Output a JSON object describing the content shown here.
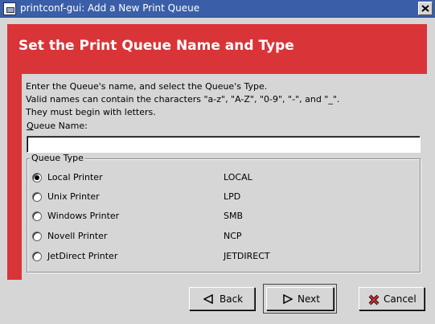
{
  "window": {
    "title": "printconf-gui: Add a New Print Queue"
  },
  "header": {
    "title": "Set the Print Queue Name and Type"
  },
  "instructions": [
    "Enter the Queue's name, and select the Queue's Type.",
    "Valid names can contain the characters \"a-z\", \"A-Z\", \"0-9\", \"-\", and \"_\".",
    "They must begin with letters."
  ],
  "queue_name": {
    "label_mnemonic": "Q",
    "label_rest": "ueue Name:",
    "value": ""
  },
  "queue_type": {
    "legend": "Queue Type",
    "options": [
      {
        "label": "Local Printer",
        "type": "LOCAL",
        "checked": true
      },
      {
        "label": "Unix Printer",
        "type": "LPD",
        "checked": false
      },
      {
        "label": "Windows Printer",
        "type": "SMB",
        "checked": false
      },
      {
        "label": "Novell Printer",
        "type": "NCP",
        "checked": false
      },
      {
        "label": "JetDirect Printer",
        "type": "JETDIRECT",
        "checked": false
      }
    ]
  },
  "buttons": {
    "back": "Back",
    "next": "Next",
    "cancel": "Cancel"
  },
  "colors": {
    "header_red": "#d93538",
    "titlebar_blue": "#3a5fa8",
    "dialog_gray": "#d6d6d6"
  },
  "icons": {
    "close": "close-icon",
    "back": "left-triangle-icon",
    "next": "right-triangle-icon",
    "cancel": "red-x-icon"
  }
}
